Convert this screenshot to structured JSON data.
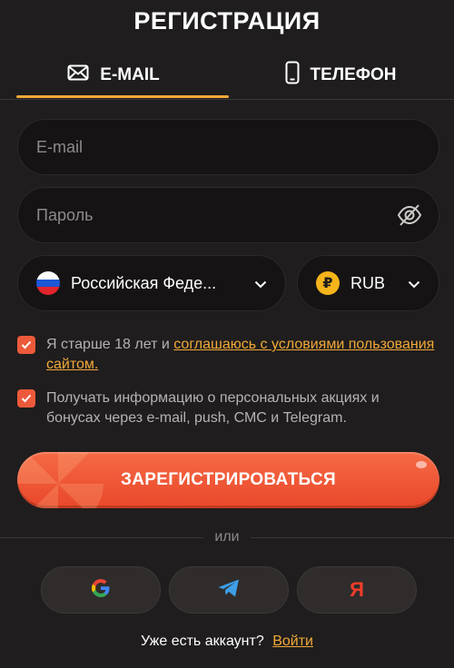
{
  "header": {
    "title": "РЕГИСТРАЦИЯ"
  },
  "tabs": [
    {
      "label": "E-MAIL",
      "icon": "envelope-icon",
      "active": true
    },
    {
      "label": "ТЕЛЕФОН",
      "icon": "phone-icon",
      "active": false
    }
  ],
  "form": {
    "email": {
      "placeholder": "E-mail",
      "value": ""
    },
    "password": {
      "placeholder": "Пароль",
      "value": ""
    },
    "country": {
      "value": "Российская Феде...",
      "icon": "russia-flag-icon"
    },
    "currency": {
      "value": "RUB",
      "symbol": "₽",
      "icon": "ruble-coin-icon"
    }
  },
  "consents": [
    {
      "checked": true,
      "text": "Я старше 18 лет и ",
      "link": "соглашаюсь с условиями пользования сайтом."
    },
    {
      "checked": true,
      "text": "Получать информацию о персональных акциях и бонусах через e-mail, push, СМС и Telegram."
    }
  ],
  "register_button": {
    "label": "ЗАРЕГИСТРИРОВАТЬСЯ"
  },
  "divider": {
    "label": "или"
  },
  "social": [
    {
      "name": "google",
      "icon": "google-icon"
    },
    {
      "name": "telegram",
      "icon": "telegram-icon"
    },
    {
      "name": "yandex",
      "icon": "yandex-icon",
      "glyph": "Я"
    }
  ],
  "footer": {
    "text": "Уже есть аккаунт?",
    "link": "Войти"
  },
  "colors": {
    "background": "#1f1d1d",
    "field": "#151313",
    "accent": "#f2a938",
    "checkbox": "#ec5a3b",
    "button": "#ec5230"
  }
}
